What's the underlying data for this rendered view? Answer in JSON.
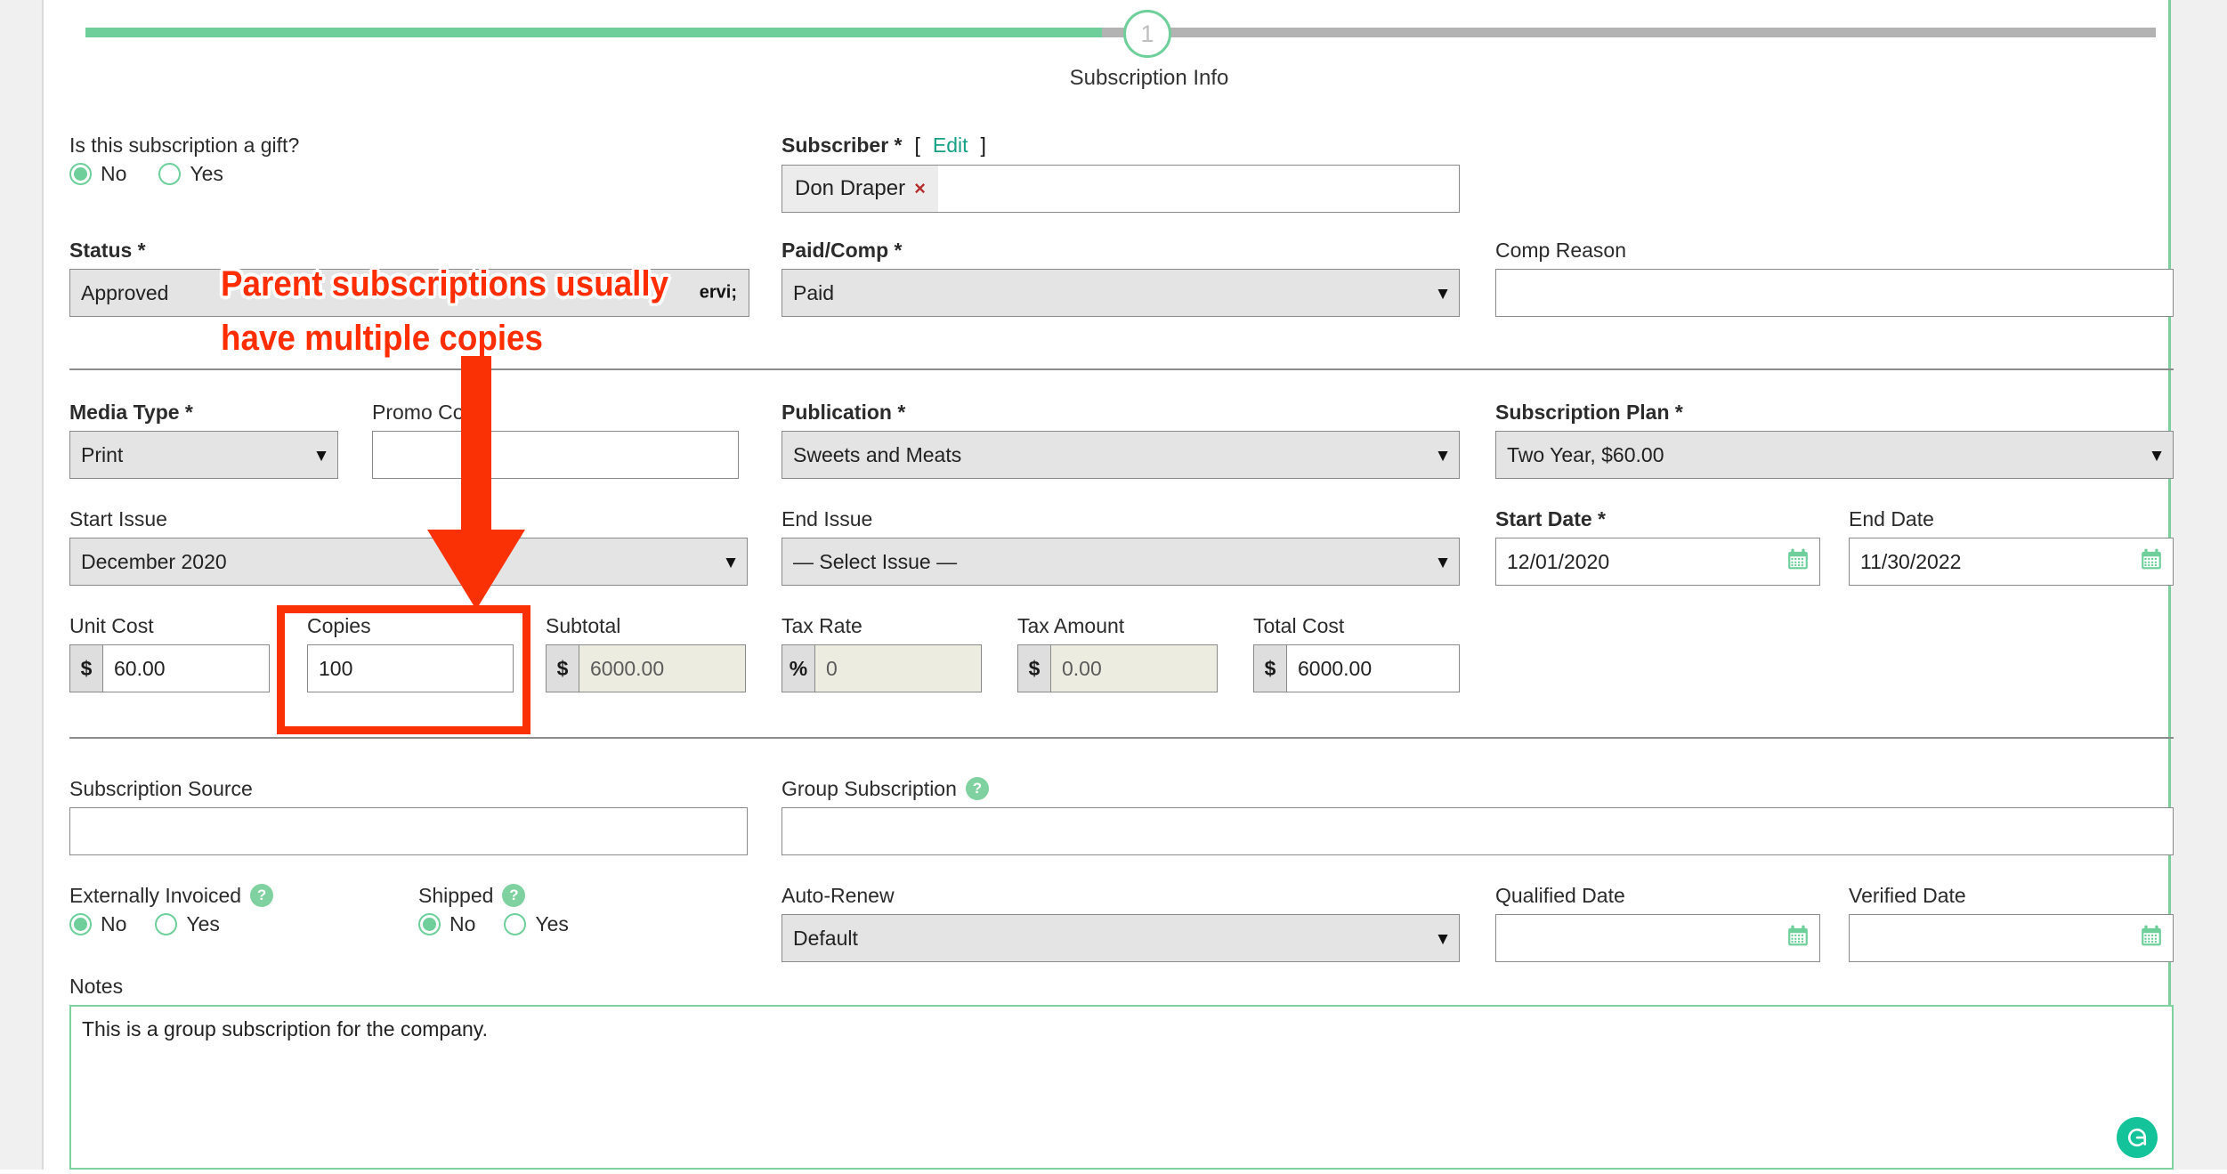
{
  "wizard": {
    "step_number": "1",
    "step_label": "Subscription Info",
    "progress_color": "#6ecf9a"
  },
  "form": {
    "gift": {
      "label": "Is this subscription a gift?",
      "options": [
        "No",
        "Yes"
      ],
      "selected": "No"
    },
    "subscriber": {
      "label": "Subscriber *",
      "edit_link": "Edit",
      "bracket_open": "[",
      "bracket_close": "]",
      "token": "Don Draper",
      "token_remove": "×"
    },
    "status": {
      "label": "Status *",
      "value": "Approved"
    },
    "paid_comp": {
      "label": "Paid/Comp *",
      "value": "Paid"
    },
    "comp_reason": {
      "label": "Comp Reason",
      "value": ""
    },
    "media_type": {
      "label": "Media Type *",
      "value": "Print"
    },
    "promo_code": {
      "label": "Promo Code",
      "value": ""
    },
    "publication": {
      "label": "Publication *",
      "value": "Sweets and Meats"
    },
    "subscription_plan": {
      "label": "Subscription Plan *",
      "value": "Two Year, $60.00"
    },
    "start_issue": {
      "label": "Start Issue",
      "value": "December 2020"
    },
    "end_issue": {
      "label": "End Issue",
      "value": "— Select Issue —"
    },
    "start_date": {
      "label": "Start Date *",
      "value": "12/01/2020"
    },
    "end_date": {
      "label": "End Date",
      "value": "11/30/2022"
    },
    "unit_cost": {
      "label": "Unit Cost",
      "prefix": "$",
      "value": "60.00"
    },
    "copies": {
      "label": "Copies",
      "value": "100"
    },
    "subtotal": {
      "label": "Subtotal",
      "prefix": "$",
      "value": "6000.00"
    },
    "tax_rate": {
      "label": "Tax Rate",
      "prefix": "%",
      "value": "0"
    },
    "tax_amount": {
      "label": "Tax Amount",
      "prefix": "$",
      "value": "0.00"
    },
    "total_cost": {
      "label": "Total Cost",
      "prefix": "$",
      "value": "6000.00"
    },
    "subscription_source": {
      "label": "Subscription Source",
      "value": ""
    },
    "group_subscription": {
      "label": "Group Subscription",
      "help": "?",
      "value": ""
    },
    "externally_invoiced": {
      "label": "Externally Invoiced",
      "help": "?",
      "options": [
        "No",
        "Yes"
      ],
      "selected": "No"
    },
    "shipped": {
      "label": "Shipped",
      "help": "?",
      "options": [
        "No",
        "Yes"
      ],
      "selected": "No"
    },
    "auto_renew": {
      "label": "Auto-Renew",
      "value": "Default"
    },
    "qualified_date": {
      "label": "Qualified Date",
      "value": ""
    },
    "verified_date": {
      "label": "Verified Date",
      "value": ""
    },
    "notes": {
      "label": "Notes",
      "value": "This is a group subscription for the company."
    }
  },
  "annotations": {
    "callout_line1": "Parent subscriptions usually",
    "callout_line2": "have multiple copies",
    "callout_color": "#ff2d00",
    "highlight_target": "Copies"
  },
  "badges": {
    "grammarly": "G"
  }
}
